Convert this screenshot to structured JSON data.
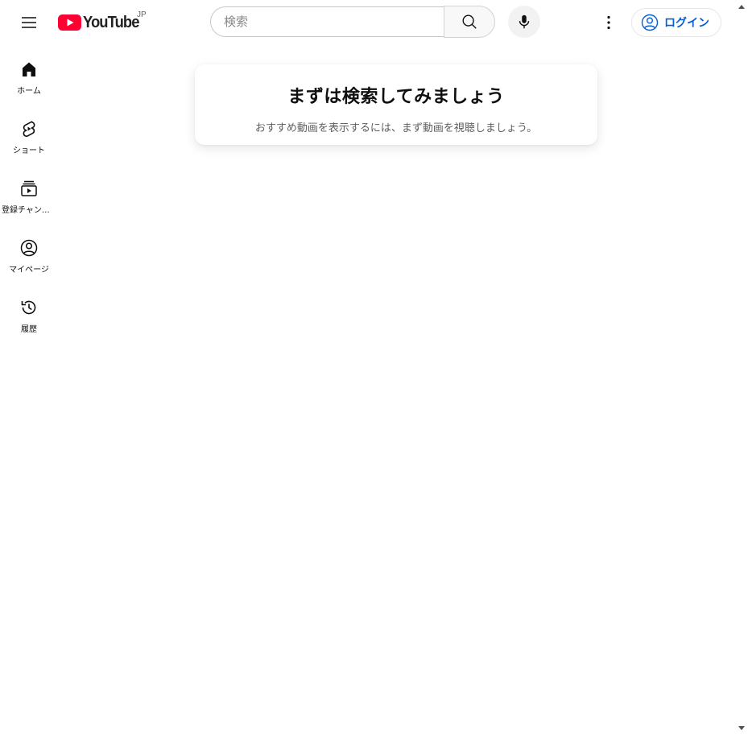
{
  "masthead": {
    "logo_text": "YouTube",
    "region_code": "JP",
    "search_placeholder": "検索",
    "search_value": "",
    "signin_label": "ログイン",
    "brand_red": "#ff0033",
    "link_blue": "#065fd4"
  },
  "guide": {
    "items": [
      {
        "label": "ホーム",
        "icon": "home-icon"
      },
      {
        "label": "ショート",
        "icon": "shorts-icon"
      },
      {
        "label": "登録チャンネル",
        "icon": "subscriptions-icon"
      },
      {
        "label": "マイページ",
        "icon": "you-icon"
      },
      {
        "label": "履歴",
        "icon": "history-icon"
      }
    ]
  },
  "prompt": {
    "title": "まずは検索してみましょう",
    "subtitle": "おすすめ動画を表示するには、まず動画を視聴しましょう。"
  }
}
